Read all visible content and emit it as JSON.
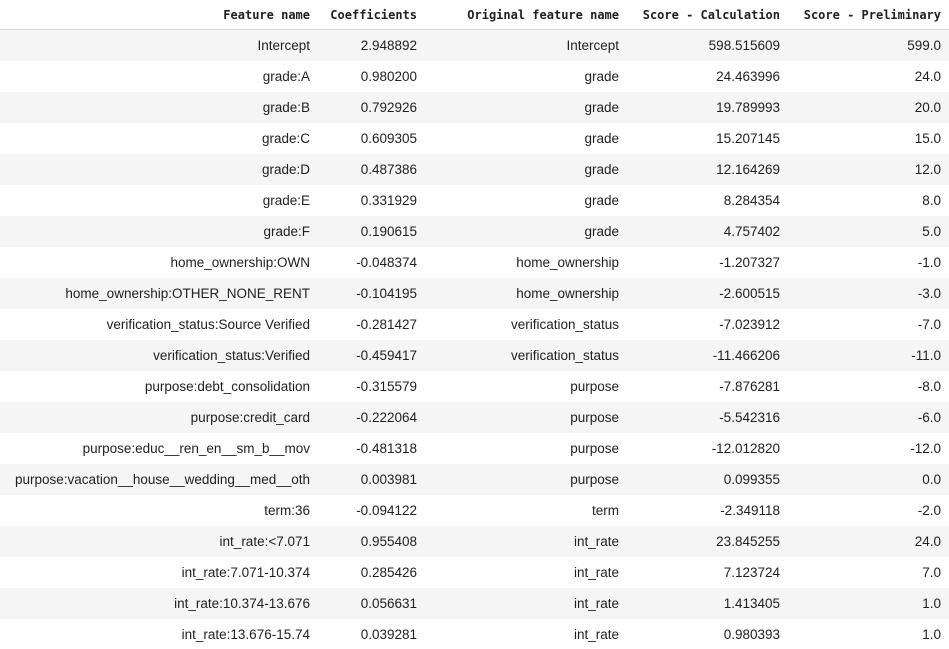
{
  "table": {
    "columns": [
      "Feature name",
      "Coefficients",
      "Original feature name",
      "Score - Calculation",
      "Score - Preliminary"
    ],
    "rows": [
      [
        "Intercept",
        "2.948892",
        "Intercept",
        "598.515609",
        "599.0"
      ],
      [
        "grade:A",
        "0.980200",
        "grade",
        "24.463996",
        "24.0"
      ],
      [
        "grade:B",
        "0.792926",
        "grade",
        "19.789993",
        "20.0"
      ],
      [
        "grade:C",
        "0.609305",
        "grade",
        "15.207145",
        "15.0"
      ],
      [
        "grade:D",
        "0.487386",
        "grade",
        "12.164269",
        "12.0"
      ],
      [
        "grade:E",
        "0.331929",
        "grade",
        "8.284354",
        "8.0"
      ],
      [
        "grade:F",
        "0.190615",
        "grade",
        "4.757402",
        "5.0"
      ],
      [
        "home_ownership:OWN",
        "-0.048374",
        "home_ownership",
        "-1.207327",
        "-1.0"
      ],
      [
        "home_ownership:OTHER_NONE_RENT",
        "-0.104195",
        "home_ownership",
        "-2.600515",
        "-3.0"
      ],
      [
        "verification_status:Source Verified",
        "-0.281427",
        "verification_status",
        "-7.023912",
        "-7.0"
      ],
      [
        "verification_status:Verified",
        "-0.459417",
        "verification_status",
        "-11.466206",
        "-11.0"
      ],
      [
        "purpose:debt_consolidation",
        "-0.315579",
        "purpose",
        "-7.876281",
        "-8.0"
      ],
      [
        "purpose:credit_card",
        "-0.222064",
        "purpose",
        "-5.542316",
        "-6.0"
      ],
      [
        "purpose:educ__ren_en__sm_b__mov",
        "-0.481318",
        "purpose",
        "-12.012820",
        "-12.0"
      ],
      [
        "purpose:vacation__house__wedding__med__oth",
        "0.003981",
        "purpose",
        "0.099355",
        "0.0"
      ],
      [
        "term:36",
        "-0.094122",
        "term",
        "-2.349118",
        "-2.0"
      ],
      [
        "int_rate:<7.071",
        "0.955408",
        "int_rate",
        "23.845255",
        "24.0"
      ],
      [
        "int_rate:7.071-10.374",
        "0.285426",
        "int_rate",
        "7.123724",
        "7.0"
      ],
      [
        "int_rate:10.374-13.676",
        "0.056631",
        "int_rate",
        "1.413405",
        "1.0"
      ],
      [
        "int_rate:13.676-15.74",
        "0.039281",
        "int_rate",
        "0.980393",
        "1.0"
      ]
    ]
  }
}
